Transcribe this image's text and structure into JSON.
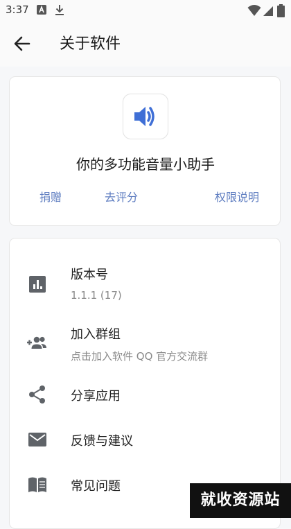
{
  "status_bar": {
    "time": "3:37"
  },
  "header": {
    "title": "关于软件"
  },
  "about_card": {
    "tagline": "你的多功能音量小助手",
    "links": {
      "donate": "捐赠",
      "rate": "去评分",
      "permissions": "权限说明"
    }
  },
  "list": {
    "items": [
      {
        "title": "版本号",
        "subtitle": "1.1.1 (17)"
      },
      {
        "title": "加入群组",
        "subtitle": "点击加入软件 QQ 官方交流群"
      },
      {
        "title": "分享应用"
      },
      {
        "title": "反馈与建议"
      },
      {
        "title": "常见问题"
      }
    ]
  },
  "watermark": {
    "text": "就收资源站"
  },
  "colors": {
    "accent": "#5d7cc0",
    "icon_gray": "#5f6368",
    "speaker_blue": "#3f6fd6"
  },
  "icons": [
    "back-arrow-icon",
    "speaker-icon",
    "bar-chart-icon",
    "group-add-icon",
    "share-icon",
    "mail-icon",
    "book-icon"
  ]
}
